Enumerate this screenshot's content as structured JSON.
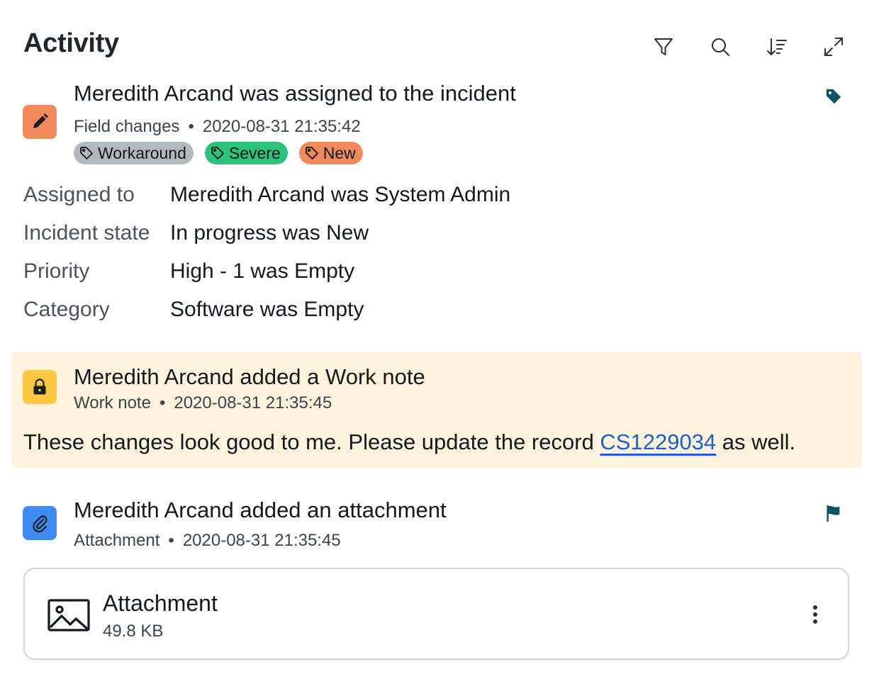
{
  "header": {
    "title": "Activity"
  },
  "toolbar": {
    "icons": [
      "filter-icon",
      "search-icon",
      "sort-icon",
      "expand-icon"
    ]
  },
  "entries": [
    {
      "heading": "Meredith Arcand was assigned to the incident",
      "type": "Field changes",
      "timestamp": "2020-08-31 21:35:42",
      "icon": "pencil-icon",
      "icon_bg": "#f28a5c",
      "corner_icon": "tag-icon",
      "chips": [
        {
          "label": "Workaround",
          "color": "#b3b8bc"
        },
        {
          "label": "Severe",
          "color": "#2dc27a"
        },
        {
          "label": "New",
          "color": "#f28a5c"
        }
      ],
      "fields": [
        {
          "label": "Assigned to",
          "value": "Meredith Arcand was System Admin"
        },
        {
          "label": "Incident state",
          "value": "In progress was New"
        },
        {
          "label": "Priority",
          "value": "High - 1 was Empty"
        },
        {
          "label": "Category",
          "value": "Software was Empty"
        }
      ]
    },
    {
      "heading": "Meredith Arcand added a Work note",
      "type": "Work note",
      "timestamp": "2020-08-31 21:35:45",
      "icon": "lock-icon",
      "icon_bg": "#fcc741",
      "background": "#fdf3dc",
      "body_before": "These changes look good to me. Please update the record ",
      "body_link": "CS1229034",
      "body_after": " as well."
    },
    {
      "heading": "Meredith Arcand added an attachment",
      "type": "Attachment",
      "timestamp": "2020-08-31 21:35:45",
      "icon": "paperclip-icon",
      "icon_bg": "#3d8bf2",
      "corner_icon": "flag-icon",
      "attachment": {
        "name": "Attachment",
        "size": "49.8 KB",
        "icon": "image-icon"
      }
    }
  ],
  "colors": {
    "accent_dark": "#0b5468",
    "link": "#1b5fd1"
  }
}
